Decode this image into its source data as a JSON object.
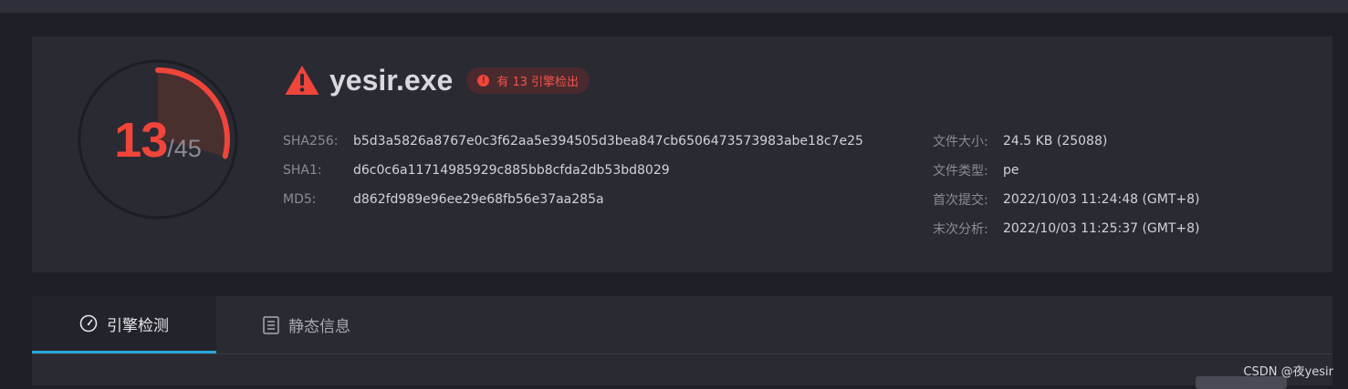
{
  "score": {
    "detected": "13",
    "total": "/45",
    "detected_count": 13,
    "total_count": 45,
    "color": "#f0453a"
  },
  "file": {
    "name": "yesir.exe",
    "warning_icon": "warning-triangle-icon",
    "badge": "有 13 引擎检出"
  },
  "hashes": [
    {
      "label": "SHA256:",
      "value": "b5d3a5826a8767e0c3f62aa5e394505d3bea847cb6506473573983abe18c7e25"
    },
    {
      "label": "SHA1:",
      "value": "d6c0c6a11714985929c885bb8cfda2db53bd8029"
    },
    {
      "label": "MD5:",
      "value": "d862fd989e96ee29e68fb56e37aa285a"
    }
  ],
  "meta": [
    {
      "label": "文件大小:",
      "value": "24.5 KB (25088)"
    },
    {
      "label": "文件类型:",
      "value": "pe"
    },
    {
      "label": "首次提交:",
      "value": "2022/10/03 11:24:48 (GMT+8)"
    },
    {
      "label": "末次分析:",
      "value": "2022/10/03 11:25:37 (GMT+8)"
    }
  ],
  "tabs": [
    {
      "label": "引擎检测",
      "icon": "gauge-icon",
      "active": true
    },
    {
      "label": "静态信息",
      "icon": "document-list-icon",
      "active": false
    }
  ],
  "watermark": "CSDN @夜yesir",
  "colors": {
    "accent_red": "#f0453a",
    "tab_underline": "#2aa6d8",
    "background": "#1f1f27",
    "card": "#2a2a33"
  }
}
